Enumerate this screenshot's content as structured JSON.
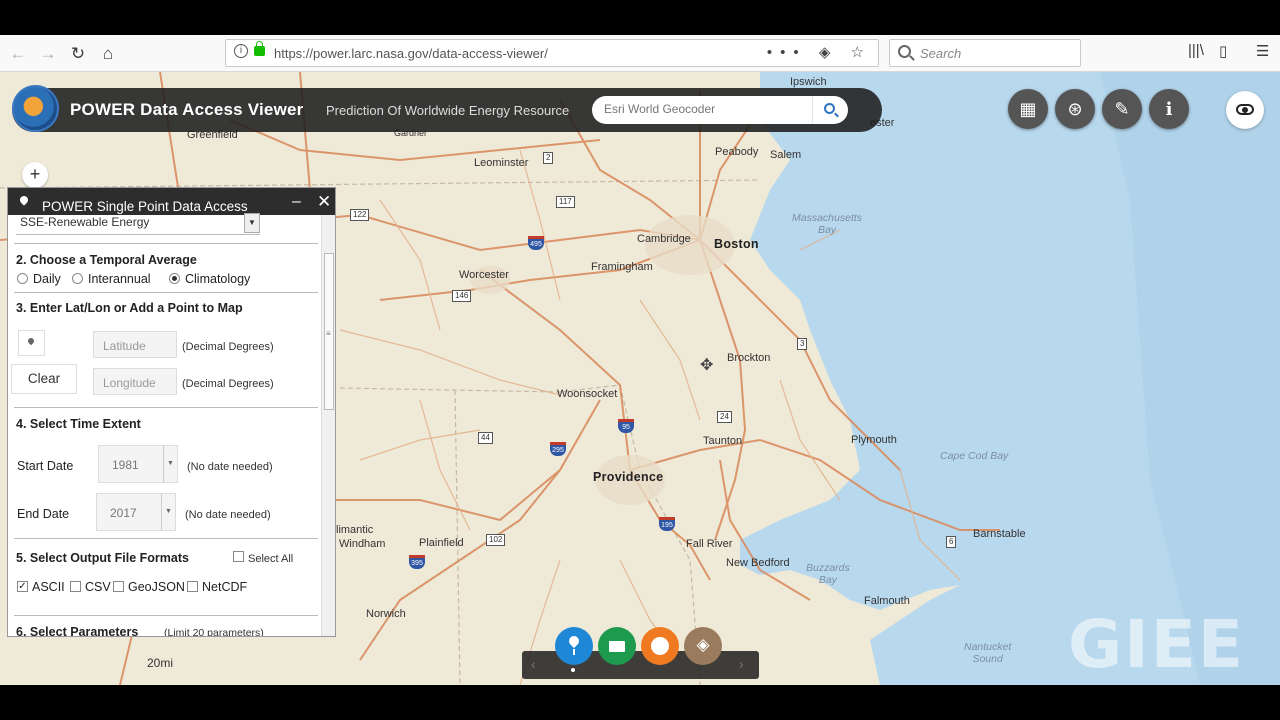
{
  "browser": {
    "url": "https://power.larc.nasa.gov/data-access-viewer/",
    "search_placeholder": "Search"
  },
  "app": {
    "title": "POWER Data Access Viewer",
    "subtitle": "Prediction Of Worldwide Energy Resource",
    "geocoder_placeholder": "Esri World Geocoder"
  },
  "map": {
    "zoom_in": "+",
    "scale": "20mi",
    "watermark": "GIEE",
    "places": {
      "ipswich": "Ipswich",
      "gloucester": "ester",
      "greenfield": "Greenfield",
      "gardner": "Gardner",
      "leominster": "Leominster",
      "peabody": "Peabody",
      "salem": "Salem",
      "mass_bay": "Massachusetts\nBay",
      "cambridge": "Cambridge",
      "boston": "Boston",
      "worcester": "Worcester",
      "framingham": "Framingham",
      "brockton": "Brockton",
      "woonsocket": "Woonsocket",
      "taunton": "Taunton",
      "plymouth": "Plymouth",
      "cape_cod_bay": "Cape Cod Bay",
      "providence": "Providence",
      "willimantic": "limantic",
      "windham": "Windham",
      "plainfield": "Plainfield",
      "fall_river": "Fall River",
      "barnstable": "Barnstable",
      "new_bedford": "New Bedford",
      "buzzards_bay": "Buzzards\nBay",
      "falmouth": "Falmouth",
      "norwich": "Norwich",
      "nantucket_sound": "Nantucket\nSound"
    },
    "shields": {
      "r2": "2",
      "r117": "117",
      "r122": "122",
      "i495": "495",
      "r146": "146",
      "r3": "3",
      "i95": "95",
      "r24": "24",
      "r44": "44",
      "i295": "295",
      "i195": "195",
      "r102": "102",
      "i395": "395",
      "r6": "6"
    }
  },
  "panel": {
    "title": "POWER Single Point Data Access",
    "min": "–",
    "close": "✕",
    "collection_value": "SSE-Renewable Energy",
    "sec2": "2. Choose a Temporal Average",
    "daily": "Daily",
    "interannual": "Interannual",
    "climatology": "Climatology",
    "sec3": "3. Enter Lat/Lon or Add a Point to Map",
    "latitude_placeholder": "Latitude",
    "longitude_placeholder": "Longitude",
    "decimal_degrees": "(Decimal Degrees)",
    "clear": "Clear",
    "sec4": "4. Select Time Extent",
    "start_date_label": "Start Date",
    "start_date_value": "1981",
    "end_date_label": "End Date",
    "end_date_value": "2017",
    "no_date_needed": "(No date needed)",
    "sec5": "5. Select Output File Formats",
    "select_all": "Select All",
    "formats": [
      "ASCII",
      "CSV",
      "GeoJSON",
      "NetCDF"
    ],
    "sec6": "6. Select Parameters",
    "limit": "(Limit 20 parameters)"
  },
  "colors": {
    "btn_pin": "#1e88d6",
    "btn_table": "#1d9a4e",
    "btn_circle": "#f07a22",
    "btn_layers": "#9b7b5e"
  }
}
